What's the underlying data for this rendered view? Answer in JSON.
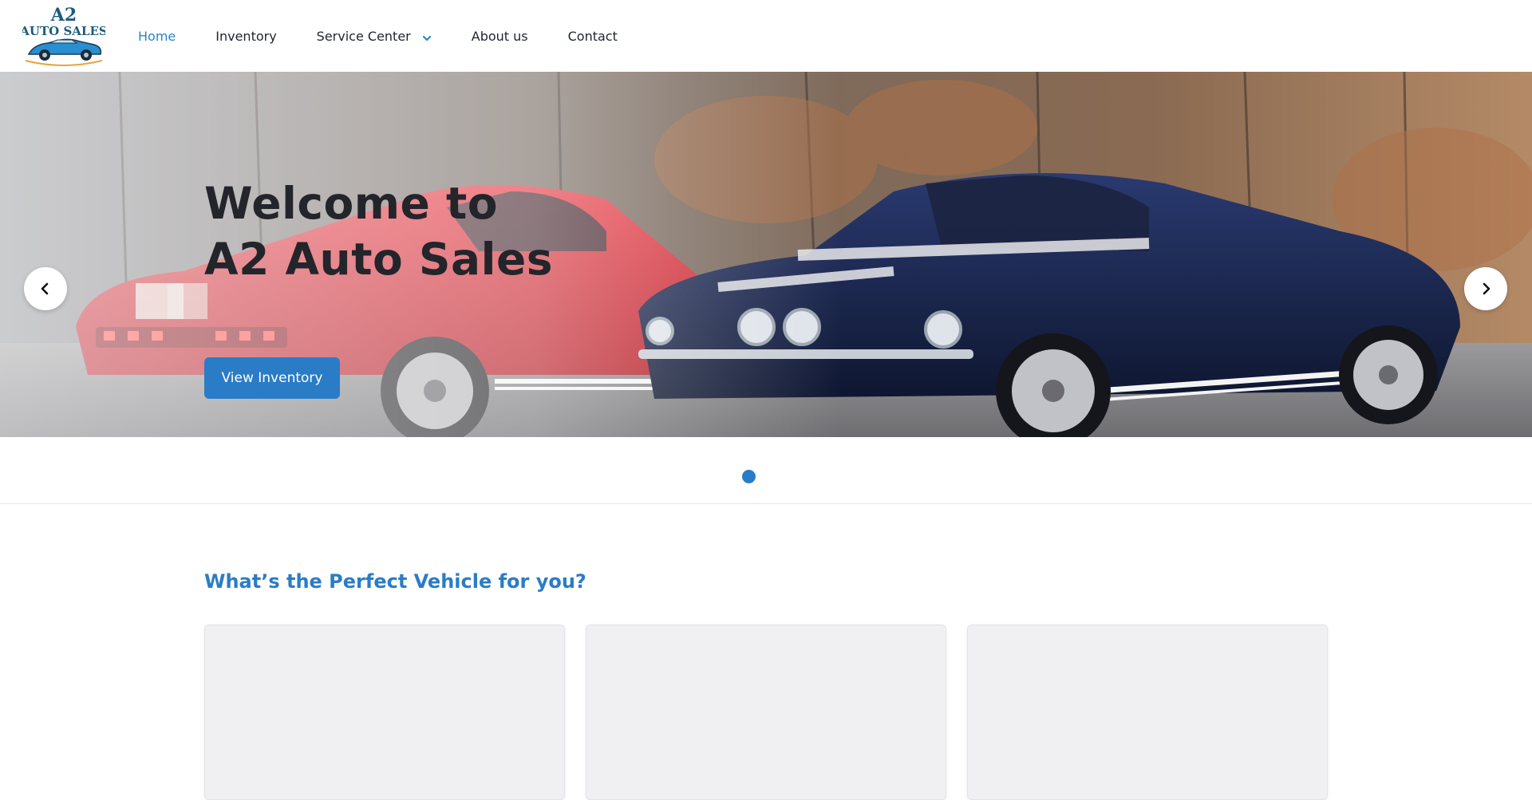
{
  "brand": {
    "logo_line1": "A2",
    "logo_line2": "AUTO SALES",
    "logo_icon": "car-logo-icon"
  },
  "nav": {
    "items": [
      {
        "label": "Home",
        "active": true
      },
      {
        "label": "Inventory",
        "active": false
      },
      {
        "label": "Service Center",
        "active": false,
        "has_dropdown": true
      },
      {
        "label": "About us",
        "active": false
      },
      {
        "label": "Contact",
        "active": false
      }
    ]
  },
  "hero": {
    "title_line1": "Welcome to",
    "title_line2": "A2 Auto Sales",
    "cta_label": "View Inventory",
    "prev_icon": "chevron-left-icon",
    "next_icon": "chevron-right-icon",
    "slide_count": 1,
    "active_slide": 1,
    "image_subject": "red and blue classic muscle cars"
  },
  "section": {
    "title": "What’s the Perfect Vehicle for you?",
    "cards": [
      {
        "id": "card-1"
      },
      {
        "id": "card-2"
      },
      {
        "id": "card-3"
      }
    ]
  },
  "colors": {
    "accent": "#2a7cc7",
    "nav_active": "#2b86c5",
    "text_dark": "#23252b",
    "card_bg": "#f0f0f2"
  }
}
